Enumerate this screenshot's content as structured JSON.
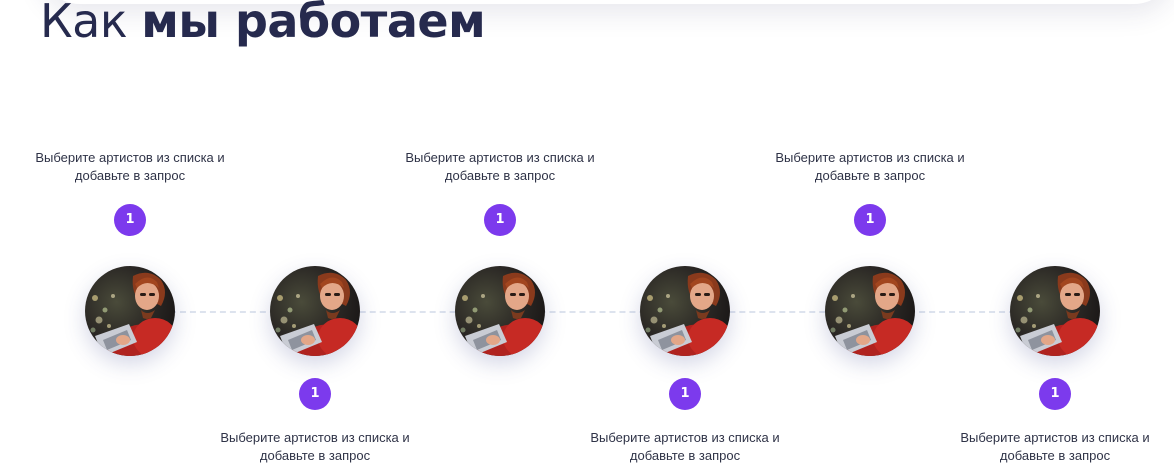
{
  "heading": {
    "regular": "Как",
    "bold": "мы работаем"
  },
  "colors": {
    "accent": "#7c3aed",
    "heading": "#262a4e",
    "timeline": "#dde3ee"
  },
  "steps": [
    {
      "number": "1",
      "caption": "Выберите артистов из списка и добавьте в запрос",
      "photo": "person-with-laptop-photo"
    },
    {
      "number": "1",
      "caption": "Выберите артистов из списка и добавьте в запрос",
      "photo": "person-with-laptop-photo"
    },
    {
      "number": "1",
      "caption": "Выберите артистов из списка и добавьте в запрос",
      "photo": "person-with-laptop-photo"
    },
    {
      "number": "1",
      "caption": "Выберите артистов из списка и добавьте в запрос",
      "photo": "person-with-laptop-photo"
    },
    {
      "number": "1",
      "caption": "Выберите артистов из списка и добавьте в запрос",
      "photo": "person-with-laptop-photo"
    },
    {
      "number": "1",
      "caption": "Выберите артистов из списка и добавьте в запрос",
      "photo": "person-with-laptop-photo"
    }
  ]
}
